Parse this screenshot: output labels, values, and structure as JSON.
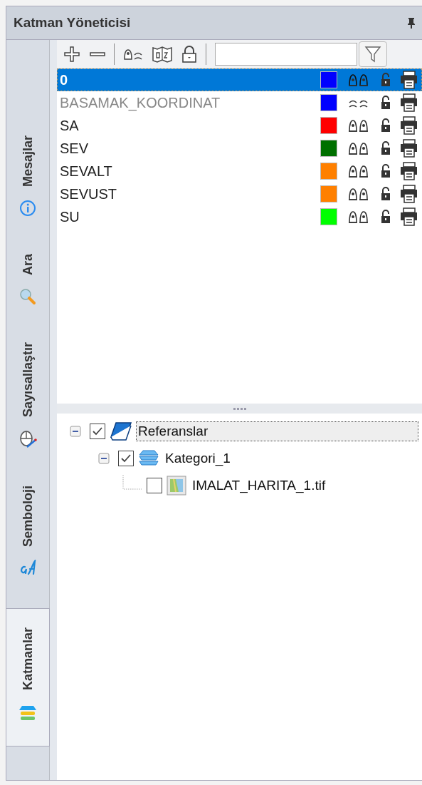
{
  "panel": {
    "title": "Katman Yöneticisi"
  },
  "side_tabs": [
    {
      "label": "Mesajlar",
      "kind": "info",
      "selected": false
    },
    {
      "label": "Ara",
      "kind": "search",
      "selected": false
    },
    {
      "label": "Sayısallaştır",
      "kind": "digitize",
      "selected": false
    },
    {
      "label": "Semboloji",
      "kind": "symbology",
      "selected": false
    },
    {
      "label": "Katmanlar",
      "kind": "layers",
      "selected": true
    }
  ],
  "layers": [
    {
      "name": "0",
      "color": "#0000ff",
      "visible": true,
      "locked": false,
      "selected": true
    },
    {
      "name": "BASAMAK_KOORDINAT",
      "color": "#0000ff",
      "visible": false,
      "locked": false,
      "selected": false
    },
    {
      "name": "SA",
      "color": "#ff0000",
      "visible": true,
      "locked": false,
      "selected": false
    },
    {
      "name": "SEV",
      "color": "#007000",
      "visible": true,
      "locked": false,
      "selected": false
    },
    {
      "name": "SEVALT",
      "color": "#ff8000",
      "visible": true,
      "locked": false,
      "selected": false
    },
    {
      "name": "SEVUST",
      "color": "#ff8000",
      "visible": true,
      "locked": false,
      "selected": false
    },
    {
      "name": "SU",
      "color": "#00ff00",
      "visible": true,
      "locked": false,
      "selected": false
    }
  ],
  "tree": [
    {
      "label": "Referanslar",
      "kind": "book",
      "checked": true,
      "expanded": true,
      "selected": true,
      "children": [
        {
          "label": "Kategori_1",
          "kind": "category",
          "checked": true,
          "expanded": true,
          "selected": false,
          "children": [
            {
              "label": "IMALAT_HARITA_1.tif",
              "kind": "raster",
              "checked": false,
              "selected": false
            }
          ]
        }
      ]
    }
  ]
}
